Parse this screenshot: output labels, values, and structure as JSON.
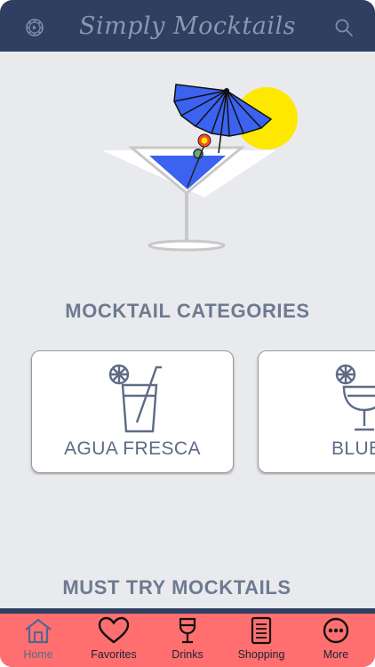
{
  "header": {
    "title": "Simply Mocktails",
    "settings_icon": "gear-icon",
    "search_icon": "search-icon"
  },
  "categories": {
    "heading": "MOCKTAIL CATEGORIES",
    "items": [
      {
        "label": "AGUA FRESCA",
        "icon": "glass-with-straw-and-lemon-icon"
      },
      {
        "label": "BLUE",
        "icon": "stemmed-glass-with-lemon-icon"
      }
    ]
  },
  "must_try": {
    "heading": "MUST TRY MOCKTAILS"
  },
  "tabs": [
    {
      "label": "Home",
      "icon": "home-icon",
      "active": true
    },
    {
      "label": "Favorites",
      "icon": "heart-icon",
      "active": false
    },
    {
      "label": "Drinks",
      "icon": "wine-glass-icon",
      "active": false
    },
    {
      "label": "Shopping",
      "icon": "shopping-list-icon",
      "active": false
    },
    {
      "label": "More",
      "icon": "more-icon",
      "active": false
    }
  ],
  "colors": {
    "header": "#2e3f62",
    "tabbar": "#ff6f6f",
    "background": "#e9eaee",
    "accent_blue": "#3b63f0",
    "sun_yellow": "#ffe800"
  }
}
